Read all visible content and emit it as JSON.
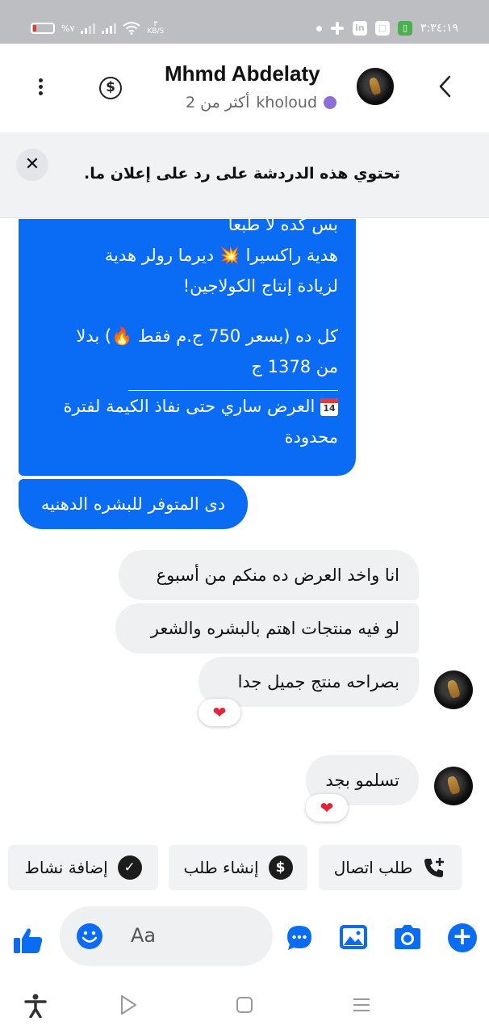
{
  "status_bar": {
    "battery_percent": "%٧",
    "speed_value": "٣",
    "speed_unit": "KB/S",
    "time": "٣:٣٤:١٩",
    "app_icons": [
      "dot-icon",
      "slack-icon",
      "linkedin-icon",
      "app-icon",
      "battery-app-icon"
    ]
  },
  "header": {
    "contact_name": "Mhmd Abdelaty",
    "sub_name": "kholoud",
    "sub_more": "أكثر من 2"
  },
  "notice": {
    "text": "تحتوي هذه الدردشة على رد على إعلان ما."
  },
  "messages": {
    "outgoing_big": {
      "line1": "بس كده لا طبعا",
      "line2": "هدية راكسيرا 💥 ديرما رولر هدية",
      "line3": "لزيادة إنتاج الكولاجين!",
      "line4": "كل ده (بسعر 750 ج.م فقط 🔥) بدلا",
      "line5": "من 1378 ج",
      "calendar_day": "14",
      "line6": "العرض ساري حتى نفاذ الكيمة لفترة",
      "line7": "محدودة"
    },
    "outgoing_small": "دى المتوفر للبشره الدهنيه",
    "incoming": [
      "انا واخد العرض ده منكم من أسبوع",
      "لو فيه منتجات اهتم بالبشره والشعر",
      "بصراحه منتج جميل جدا",
      "تسلمو بجد"
    ],
    "reaction": "❤"
  },
  "quick_actions": {
    "call_request": "طلب اتصال",
    "create_order": "إنشاء طلب",
    "add_activity": "إضافة نشاط"
  },
  "composer": {
    "placeholder": "Aa"
  },
  "colors": {
    "accent": "#0a6cf5",
    "incoming_bubble": "#eff0f2",
    "status_bar": "#bdbec1"
  }
}
